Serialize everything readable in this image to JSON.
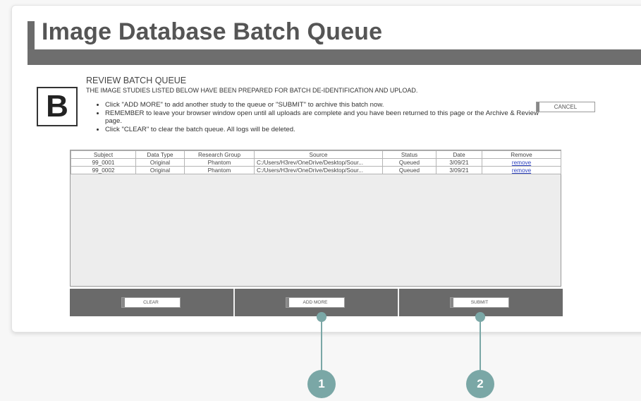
{
  "page_title": "Image Database Batch Queue",
  "step_letter": "B",
  "section": {
    "heading": "REVIEW BATCH QUEUE",
    "description": "THE IMAGE STUDIES LISTED BELOW HAVE BEEN PREPARED FOR BATCH DE-IDENTIFICATION AND UPLOAD.",
    "instructions": [
      "Click \"ADD MORE\" to add another study to the queue or \"SUBMIT\" to archive this batch now.",
      "REMEMBER to leave your browser window open until all uploads are complete and you have been returned to this page or the Archive & Review page.",
      "Click \"CLEAR\" to clear the batch queue. All logs will be deleted."
    ]
  },
  "cancel_label": "CANCEL",
  "table": {
    "headers": [
      "Subject",
      "Data Type",
      "Research Group",
      "Source",
      "Status",
      "Date",
      "Remove"
    ],
    "rows": [
      [
        "99_0001",
        "Original",
        "Phantom",
        "C:/Users/H3rev/OneDrive/Desktop/Sour...",
        "Queued",
        "3/09/21",
        "remove"
      ],
      [
        "99_0002",
        "Original",
        "Phantom",
        "C:/Users/H3rev/OneDrive/Desktop/Sour...",
        "Queued",
        "3/09/21",
        "remove"
      ]
    ]
  },
  "actions": {
    "clear_label": "CLEAR",
    "add_more_label": "ADD MORE",
    "submit_label": "SUBMIT"
  },
  "callouts": [
    "1",
    "2"
  ],
  "colors": {
    "accent_gray": "#6e6e6e",
    "callout_teal": "#7aa7a6",
    "link_blue": "#2a3fbf"
  }
}
